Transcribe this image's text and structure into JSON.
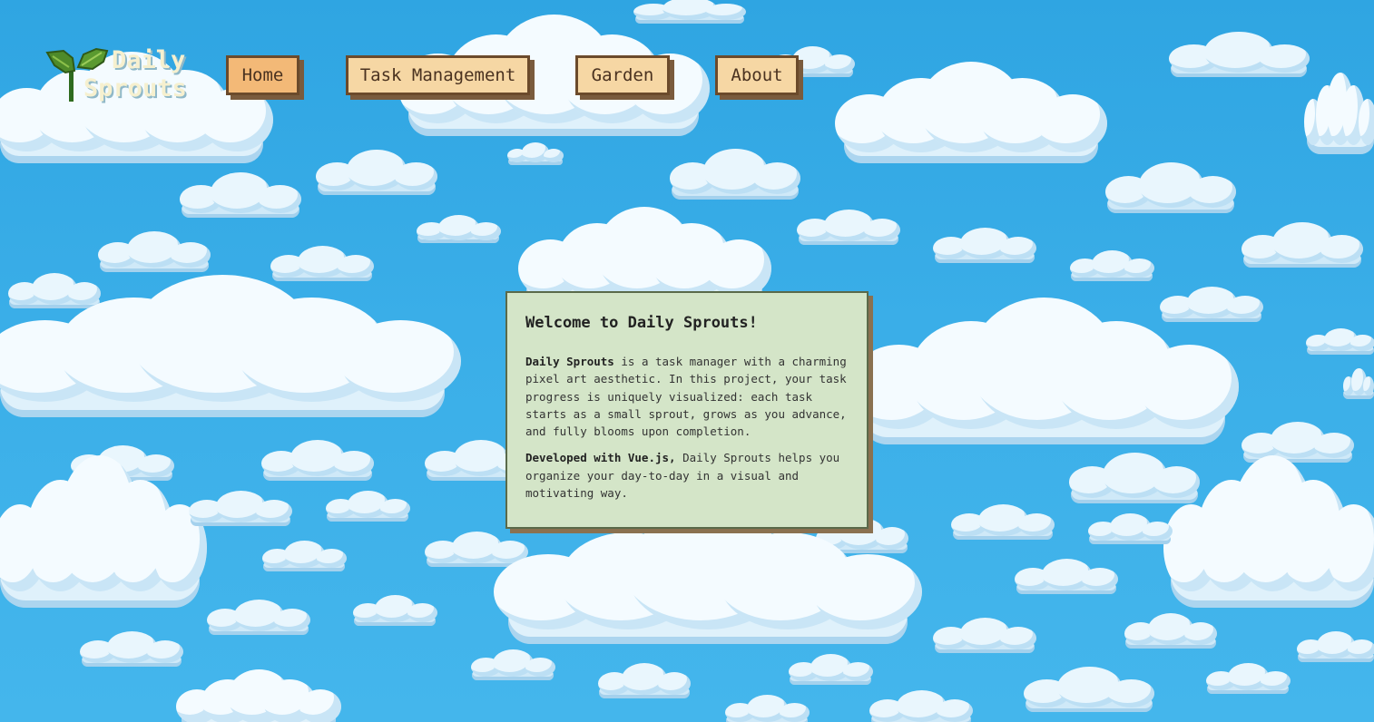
{
  "logo": {
    "line1": "Daily",
    "line2": "Sprouts",
    "icon": "sprout-icon"
  },
  "nav": {
    "items": [
      {
        "label": "Home",
        "active": true
      },
      {
        "label": "Task Management",
        "active": false
      },
      {
        "label": "Garden",
        "active": false
      },
      {
        "label": "About",
        "active": false
      }
    ]
  },
  "welcome": {
    "title": "Welcome to Daily Sprouts!",
    "p1_strong": "Daily Sprouts",
    "p1_rest": " is a task manager with a charming pixel art aesthetic. In this project, your task progress is uniquely visualized: each task starts as a small sprout, grows as you advance, and fully blooms upon completion.",
    "p2_strong": "Developed with Vue.js,",
    "p2_rest": " Daily Sprouts helps you organize your day-to-day in a visual and motivating way."
  },
  "colors": {
    "sky": "#3aaee8",
    "card_bg": "#d4e5c8",
    "nav_bg": "#f6d7a4",
    "nav_active_bg": "#f3b977",
    "nav_border": "#6b4a2b",
    "logo_leaf": "#4e8a2a"
  }
}
